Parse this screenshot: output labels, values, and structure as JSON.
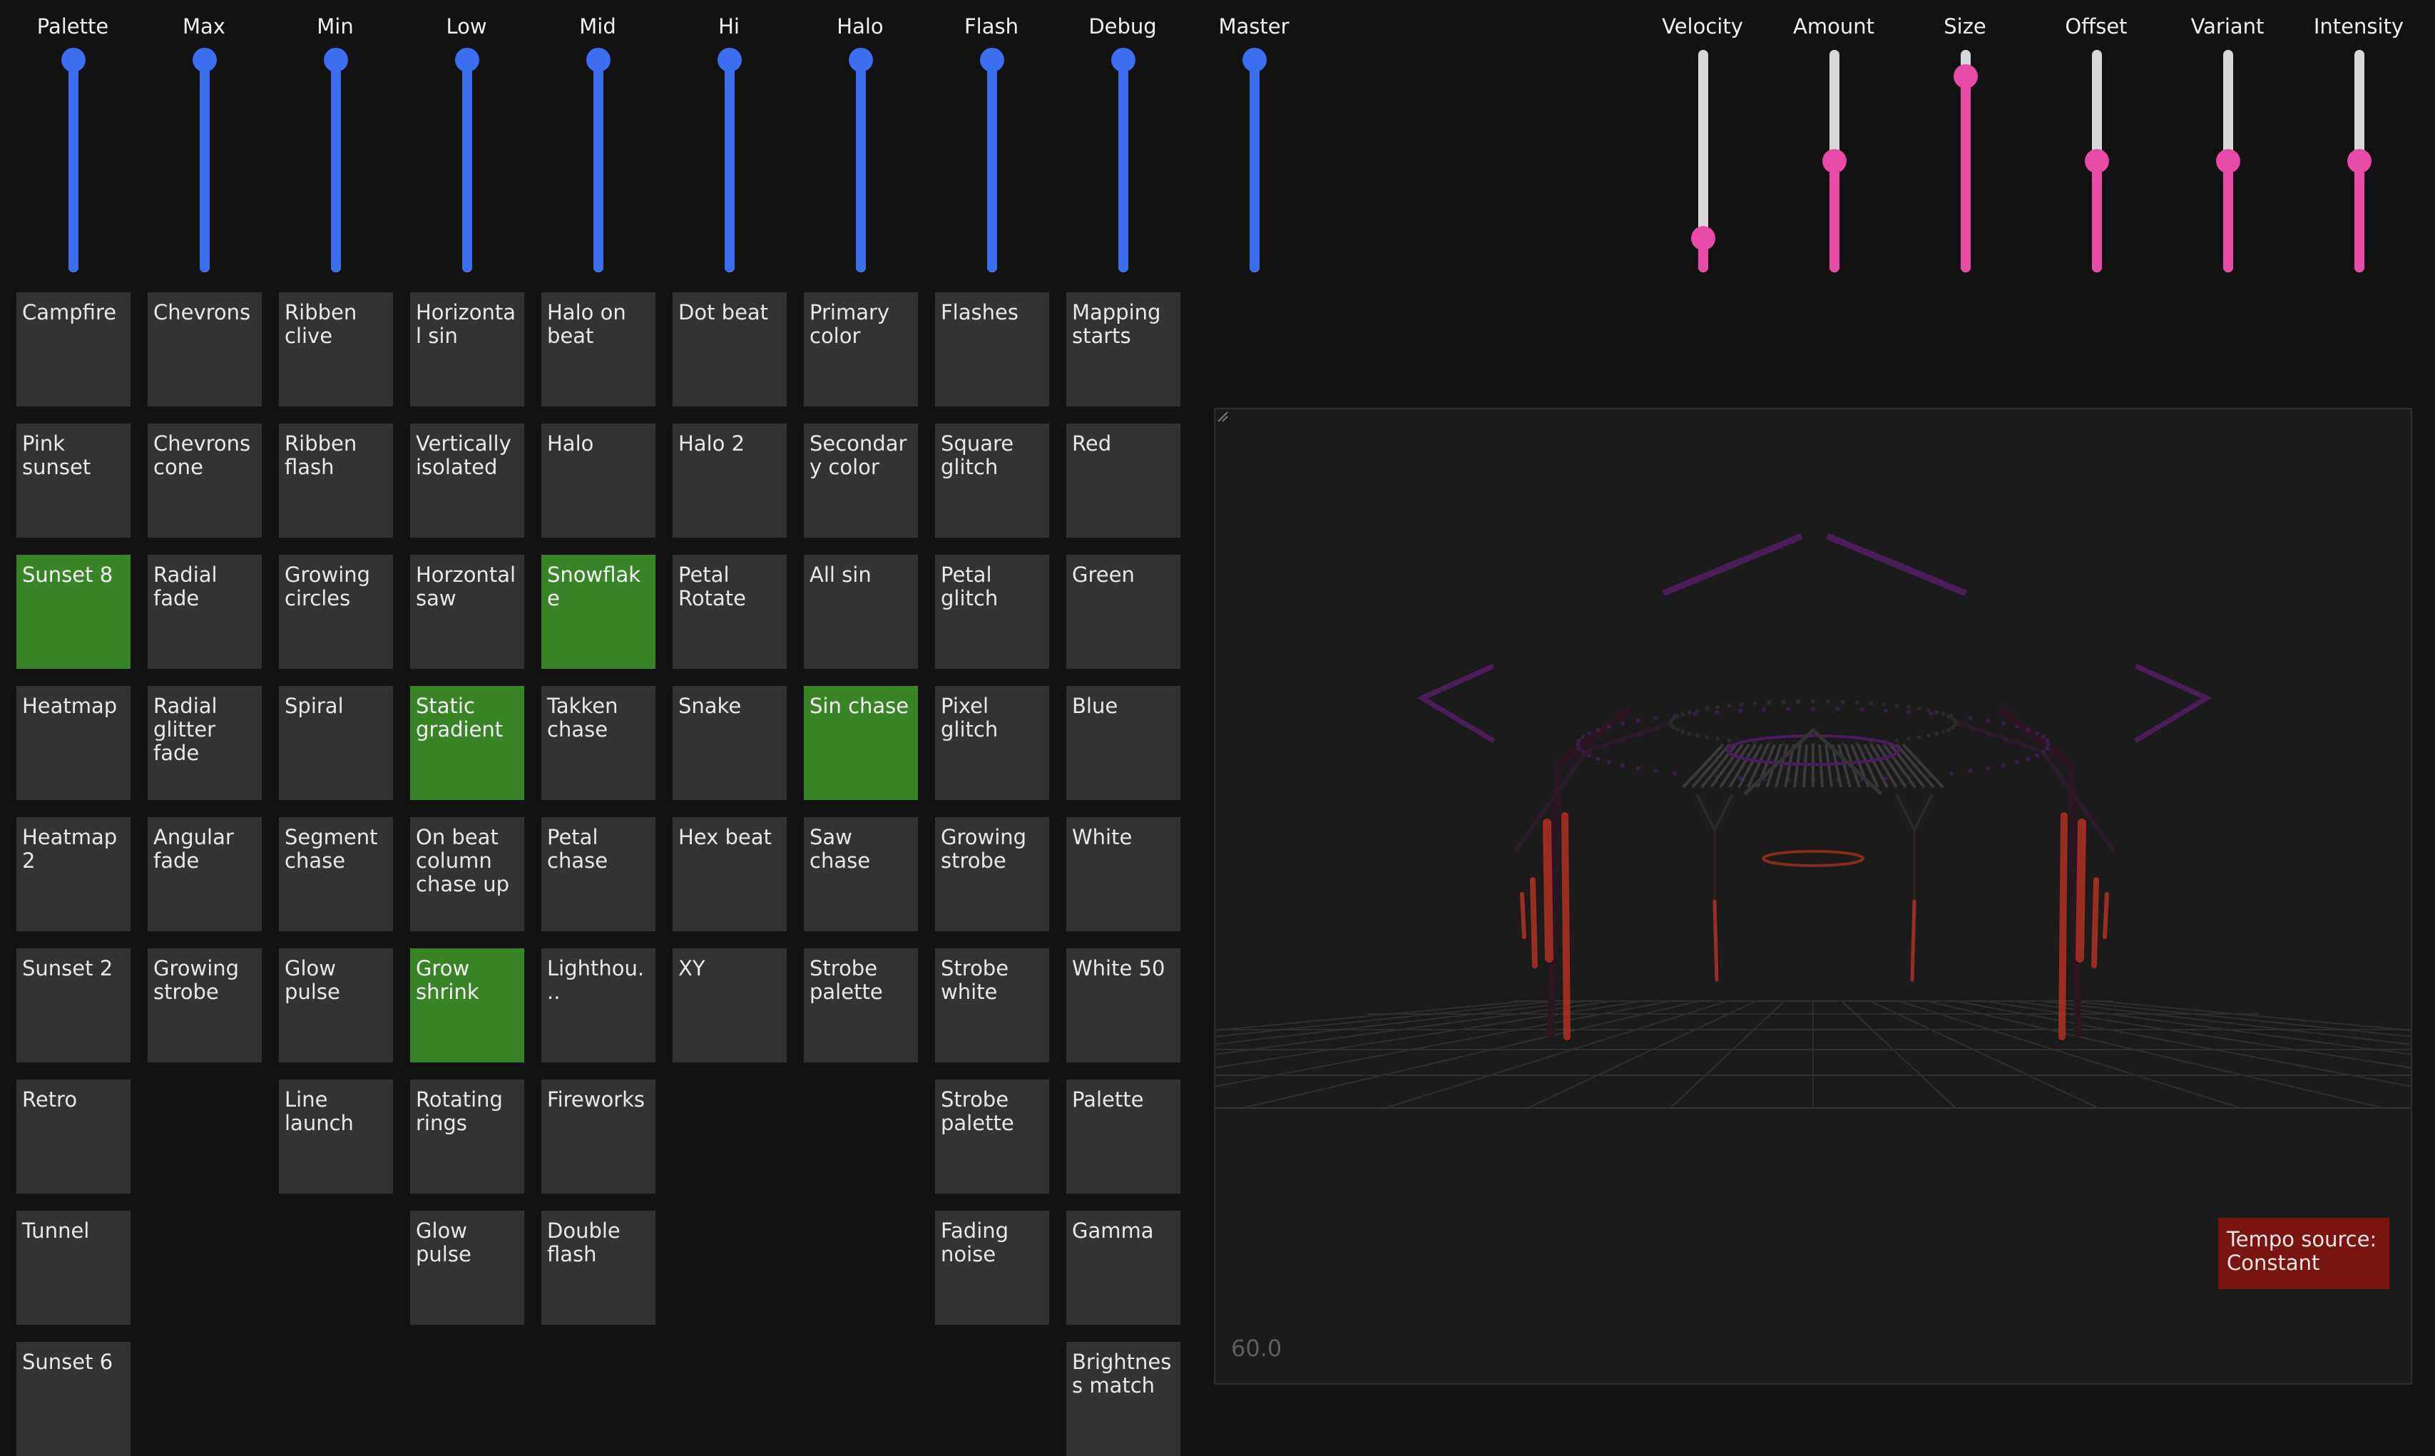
{
  "colors": {
    "background": "#121212",
    "pad": "#333333",
    "pad_active": "#3a8428",
    "slider_blue": "#3b6ff0",
    "slider_pink": "#e84aa8",
    "track": "#d8d8d8",
    "tempo_bg": "#7a1410"
  },
  "left_sliders": [
    {
      "label": "Palette",
      "value": 1.0
    },
    {
      "label": "Max",
      "value": 1.0
    },
    {
      "label": "Min",
      "value": 1.0
    },
    {
      "label": "Low",
      "value": 1.0
    },
    {
      "label": "Mid",
      "value": 1.0
    },
    {
      "label": "Hi",
      "value": 1.0
    },
    {
      "label": "Halo",
      "value": 1.0
    },
    {
      "label": "Flash",
      "value": 1.0
    },
    {
      "label": "Debug",
      "value": 1.0
    },
    {
      "label": "Master",
      "value": 1.0
    }
  ],
  "right_sliders": [
    {
      "label": "Velocity",
      "value": 0.12
    },
    {
      "label": "Amount",
      "value": 0.5
    },
    {
      "label": "Size",
      "value": 0.92
    },
    {
      "label": "Offset",
      "value": 0.5
    },
    {
      "label": "Variant",
      "value": 0.5
    },
    {
      "label": "Intensity",
      "value": 0.5
    }
  ],
  "columns": [
    {
      "name": "Palette",
      "pads": [
        {
          "label": "Campfire",
          "active": false
        },
        {
          "label": "Pink sunset",
          "active": false
        },
        {
          "label": "Sunset 8",
          "active": true
        },
        {
          "label": "Heatmap",
          "active": false
        },
        {
          "label": "Heatmap 2",
          "active": false
        },
        {
          "label": "Sunset 2",
          "active": false
        },
        {
          "label": "Retro",
          "active": false
        },
        {
          "label": "Tunnel",
          "active": false
        },
        {
          "label": "Sunset 6",
          "active": false
        }
      ]
    },
    {
      "name": "Max",
      "pads": [
        {
          "label": "Chevrons",
          "active": false
        },
        {
          "label": "Chevrons cone",
          "active": false
        },
        {
          "label": "Radial fade",
          "active": false
        },
        {
          "label": "Radial glitter fade",
          "active": false
        },
        {
          "label": "Angular fade",
          "active": false
        },
        {
          "label": "Growing strobe",
          "active": false
        }
      ]
    },
    {
      "name": "Min",
      "pads": [
        {
          "label": "Ribben clive",
          "active": false
        },
        {
          "label": "Ribben flash",
          "active": false
        },
        {
          "label": "Growing circles",
          "active": false
        },
        {
          "label": "Spiral",
          "active": false
        },
        {
          "label": "Segment chase",
          "active": false
        },
        {
          "label": "Glow pulse",
          "active": false
        },
        {
          "label": "Line launch",
          "active": false
        }
      ]
    },
    {
      "name": "Low",
      "pads": [
        {
          "label": "Horizontal sin",
          "active": false
        },
        {
          "label": "Vertically isolated",
          "active": false
        },
        {
          "label": "Horzontal saw",
          "active": false
        },
        {
          "label": "Static gradient",
          "active": true
        },
        {
          "label": "On beat column chase up",
          "active": false
        },
        {
          "label": "Grow shrink",
          "active": true
        },
        {
          "label": "Rotating rings",
          "active": false
        },
        {
          "label": "Glow pulse",
          "active": false
        }
      ]
    },
    {
      "name": "Mid",
      "pads": [
        {
          "label": "Halo on beat",
          "active": false
        },
        {
          "label": "Halo",
          "active": false
        },
        {
          "label": "Snowflake",
          "active": true
        },
        {
          "label": "Takken chase",
          "active": false
        },
        {
          "label": "Petal chase",
          "active": false
        },
        {
          "label": "Lighthou...",
          "active": false
        },
        {
          "label": "Fireworks",
          "active": false
        },
        {
          "label": "Double flash",
          "active": false
        }
      ]
    },
    {
      "name": "Hi",
      "pads": [
        {
          "label": "Dot beat",
          "active": false
        },
        {
          "label": "Halo 2",
          "active": false
        },
        {
          "label": "Petal Rotate",
          "active": false
        },
        {
          "label": "Snake",
          "active": false
        },
        {
          "label": "Hex beat",
          "active": false
        },
        {
          "label": "XY",
          "active": false
        }
      ]
    },
    {
      "name": "Halo",
      "pads": [
        {
          "label": "Primary color",
          "active": false
        },
        {
          "label": "Secondary color",
          "active": false
        },
        {
          "label": "All sin",
          "active": false
        },
        {
          "label": "Sin chase",
          "active": true
        },
        {
          "label": "Saw chase",
          "active": false
        },
        {
          "label": "Strobe palette",
          "active": false
        }
      ]
    },
    {
      "name": "Flash",
      "pads": [
        {
          "label": "Flashes",
          "active": false
        },
        {
          "label": "Square glitch",
          "active": false
        },
        {
          "label": "Petal glitch",
          "active": false
        },
        {
          "label": "Pixel glitch",
          "active": false
        },
        {
          "label": "Growing strobe",
          "active": false
        },
        {
          "label": "Strobe white",
          "active": false
        },
        {
          "label": "Strobe palette",
          "active": false
        },
        {
          "label": "Fading noise",
          "active": false
        }
      ]
    },
    {
      "name": "Debug",
      "pads": [
        {
          "label": "Mapping starts",
          "active": false
        },
        {
          "label": "Red",
          "active": false
        },
        {
          "label": "Green",
          "active": false
        },
        {
          "label": "Blue",
          "active": false
        },
        {
          "label": "White",
          "active": false
        },
        {
          "label": "White 50",
          "active": false
        },
        {
          "label": "Palette",
          "active": false
        },
        {
          "label": "Gamma",
          "active": false
        },
        {
          "label": "Brightness match",
          "active": false
        }
      ]
    }
  ],
  "viewport": {
    "fps": "60.0",
    "tempo_label": "Tempo source: Constant"
  }
}
